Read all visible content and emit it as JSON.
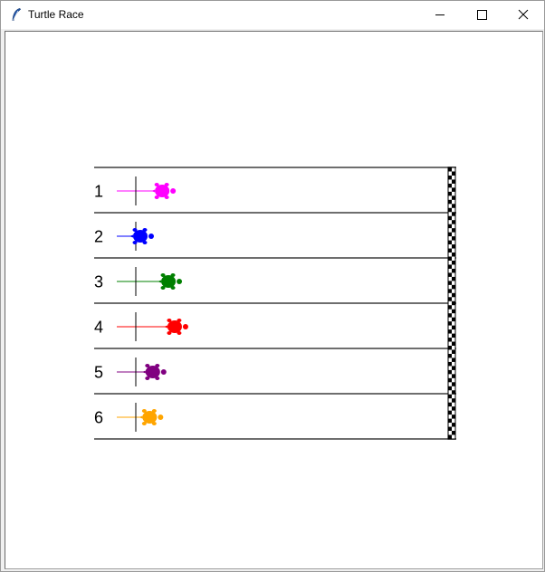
{
  "window": {
    "title": "Turtle Race"
  },
  "race": {
    "finish_line": "checkered",
    "lanes": [
      {
        "number": "1",
        "color": "#ff00ff",
        "progress": 0.07
      },
      {
        "number": "2",
        "color": "#0000ff",
        "progress": 0.0
      },
      {
        "number": "3",
        "color": "#008000",
        "progress": 0.09
      },
      {
        "number": "4",
        "color": "#ff0000",
        "progress": 0.11
      },
      {
        "number": "5",
        "color": "#800080",
        "progress": 0.04
      },
      {
        "number": "6",
        "color": "#ffa500",
        "progress": 0.03
      }
    ]
  }
}
